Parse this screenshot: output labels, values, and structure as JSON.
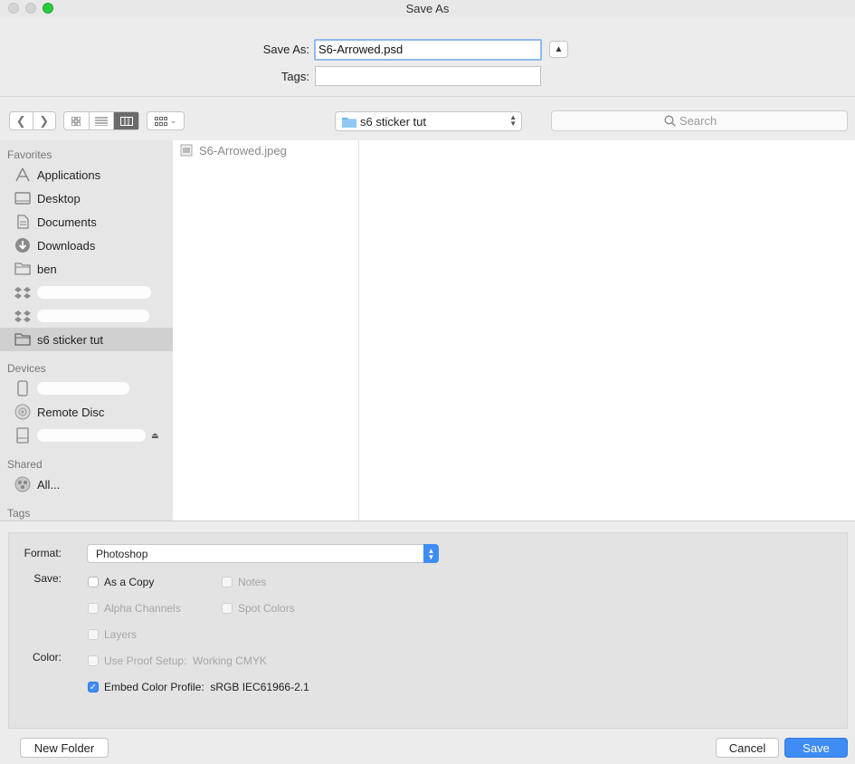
{
  "window": {
    "title": "Save As"
  },
  "header": {
    "save_as_label": "Save As:",
    "filename": "S6-Arrowed.psd",
    "tags_label": "Tags:",
    "tags_value": ""
  },
  "toolbar": {
    "current_folder": "s6 sticker tut",
    "search_placeholder": "Search"
  },
  "sidebar": {
    "favorites_label": "Favorites",
    "favorites": [
      {
        "label": "Applications",
        "icon": "applications-icon"
      },
      {
        "label": "Desktop",
        "icon": "desktop-icon"
      },
      {
        "label": "Documents",
        "icon": "documents-icon"
      },
      {
        "label": "Downloads",
        "icon": "downloads-icon"
      },
      {
        "label": "ben",
        "icon": "folder-icon"
      },
      {
        "label": "",
        "icon": "dropbox-icon"
      },
      {
        "label": "",
        "icon": "dropbox-icon"
      },
      {
        "label": "s6 sticker tut",
        "icon": "folder-icon",
        "selected": true
      }
    ],
    "devices_label": "Devices",
    "devices": [
      {
        "label": "",
        "icon": "phone-icon"
      },
      {
        "label": "Remote Disc",
        "icon": "disc-icon"
      },
      {
        "label": "",
        "icon": "drive-icon"
      }
    ],
    "shared_label": "Shared",
    "shared": [
      {
        "label": "All...",
        "icon": "network-icon"
      }
    ],
    "tags_label": "Tags"
  },
  "browser": {
    "files": [
      {
        "name": "S6-Arrowed.jpeg",
        "icon": "image-file-icon"
      }
    ]
  },
  "options": {
    "format_label": "Format:",
    "format_value": "Photoshop",
    "save_label": "Save:",
    "color_label": "Color:",
    "checkboxes": {
      "as_a_copy": {
        "label": "As a Copy",
        "checked": false,
        "enabled": true
      },
      "notes": {
        "label": "Notes",
        "checked": false,
        "enabled": false
      },
      "alpha_channels": {
        "label": "Alpha Channels",
        "checked": false,
        "enabled": false
      },
      "spot_colors": {
        "label": "Spot Colors",
        "checked": false,
        "enabled": false
      },
      "layers": {
        "label": "Layers",
        "checked": false,
        "enabled": false
      },
      "use_proof_setup": {
        "label": "Use Proof Setup:  Working CMYK",
        "checked": false,
        "enabled": false
      },
      "embed_color_profile": {
        "label": "Embed Color Profile:  sRGB IEC61966-2.1",
        "checked": true,
        "enabled": true
      }
    }
  },
  "footer": {
    "new_folder_label": "New Folder",
    "cancel_label": "Cancel",
    "save_label": "Save"
  },
  "colors": {
    "accent": "#3f8cf5",
    "sidebar_bg": "#e6e6e6",
    "window_bg": "#ececec"
  }
}
